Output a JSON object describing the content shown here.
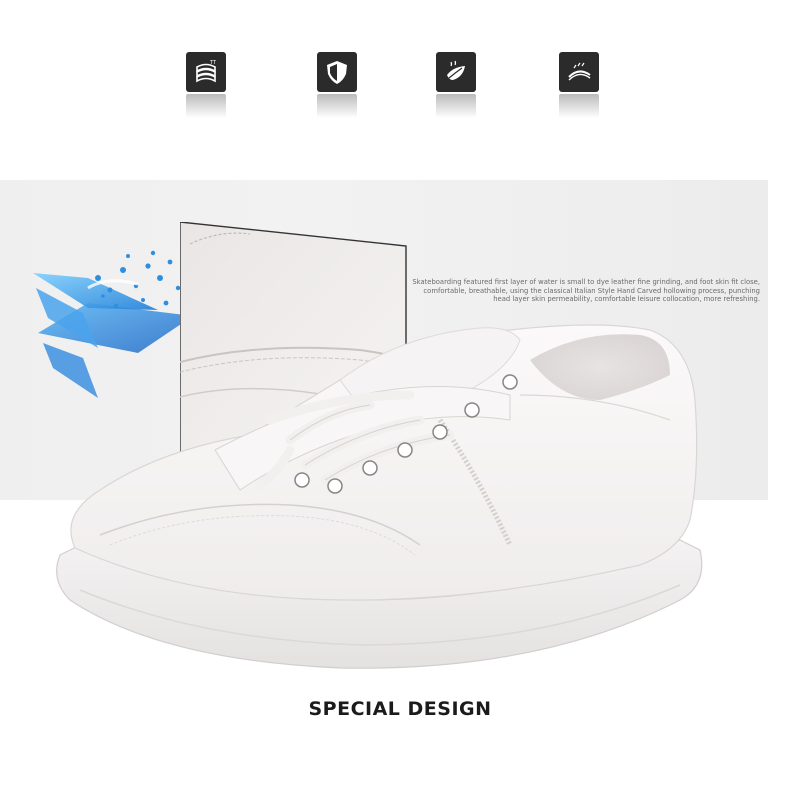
{
  "feature_icons": [
    {
      "icon": "layered-fabric-icon"
    },
    {
      "icon": "shield-icon"
    },
    {
      "icon": "breathable-leaf-icon"
    },
    {
      "icon": "flexible-sole-icon"
    }
  ],
  "description": "Skateboarding featured first layer of water is small to dye leather fine grinding, and foot skin fit close, comfortable, breathable, using the classical Italian Style Hand Carved hollowing process, punching head layer skin permeability, comfortable leisure collocation, more refreshing.",
  "headline": "SPECIAL DESIGN",
  "colors": {
    "icon_bg": "#2b2b2b",
    "banner_bg": "#efefef",
    "accent_blue": "#3aa0e8",
    "shoe_white": "#f7f5f5"
  }
}
